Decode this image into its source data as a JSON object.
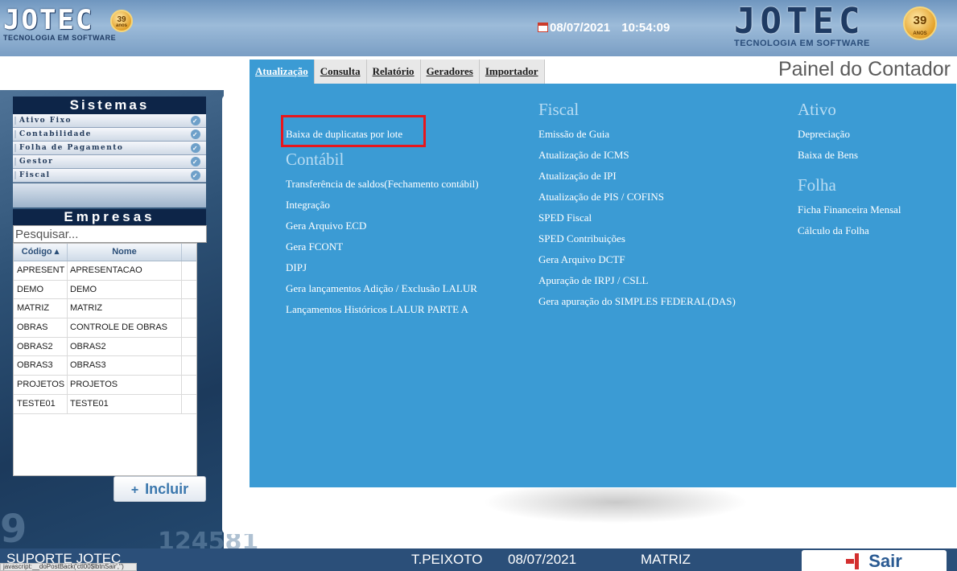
{
  "header": {
    "logo_small": {
      "word": "JOTEC",
      "tagline": "TECNOLOGIA EM SOFTWARE",
      "badge_number": "39",
      "badge_word": "anos"
    },
    "logo_big": {
      "word": "JOTEC",
      "tagline": "TECNOLOGIA EM SOFTWARE",
      "badge_number": "39",
      "badge_word": "ANOS"
    },
    "date": "08/07/2021",
    "time": "10:54:09",
    "calendar_icon": "calendar-icon"
  },
  "menubar": {
    "items": [
      {
        "label": "Atualização",
        "active": true
      },
      {
        "label": "Consulta"
      },
      {
        "label": "Relatório"
      },
      {
        "label": "Geradores"
      },
      {
        "label": "Importador"
      }
    ]
  },
  "panel_title": "Painel do Contador",
  "sidebar": {
    "sistemas_title": "Sistemas",
    "sistemas": [
      "Ativo Fixo",
      "Contabilidade",
      "Folha de Pagamento",
      "Gestor",
      "Fiscal"
    ],
    "empresas_title": "Empresas",
    "search_placeholder": "Pesquisar...",
    "columns": [
      "Código ▴",
      "Nome"
    ],
    "rows": [
      [
        "APRESENT",
        "APRESENTACAO"
      ],
      [
        "DEMO",
        "DEMO"
      ],
      [
        "MATRIZ",
        "MATRIZ"
      ],
      [
        "OBRAS",
        "CONTROLE DE OBRAS"
      ],
      [
        "OBRAS2",
        "OBRAS2"
      ],
      [
        "OBRAS3",
        "OBRAS3"
      ],
      [
        "PROJETOS",
        "PROJETOS"
      ],
      [
        "TESTE01",
        "TESTE01"
      ]
    ],
    "incluir_label": "Incluir",
    "bg_numbers": [
      "9",
      "124581"
    ]
  },
  "dropdown": {
    "col1": {
      "top_link": "Baixa de duplicatas por lote",
      "heading": "Contábil",
      "links": [
        "Transferência de saldos(Fechamento contábil)",
        "Integração",
        "Gera Arquivo ECD",
        "Gera FCONT",
        "DIPJ",
        "Gera lançamentos Adição / Exclusão LALUR",
        "Lançamentos Históricos LALUR PARTE A"
      ]
    },
    "col2": {
      "heading": "Fiscal",
      "links": [
        "Emissão de Guia",
        "Atualização de ICMS",
        "Atualização de IPI",
        "Atualização de PIS / COFINS",
        "SPED Fiscal",
        "SPED Contribuições",
        "Gera Arquivo DCTF",
        "Apuração de IRPJ / CSLL",
        "Gera apuração do SIMPLES FEDERAL(DAS)"
      ]
    },
    "col3": {
      "heading": "Ativo",
      "links": [
        "Depreciação",
        "Baixa de Bens"
      ],
      "heading2": "Folha",
      "links2": [
        "Ficha Financeira Mensal",
        "Cálculo da Folha"
      ]
    },
    "highlight_color": "#e8161c"
  },
  "footer": {
    "suporte": "SUPORTE JOTEC",
    "status_url": "javascript:__doPostBack('ctl00$lbtnSair','')",
    "user": "T.PEIXOTO",
    "date": "08/07/2021",
    "company": "MATRIZ",
    "sair_label": "Sair",
    "sair_icon": "exit-icon"
  },
  "colors": {
    "accent": "#3b9bd4",
    "dark": "#0d2548",
    "footer": "#2b4f79"
  }
}
